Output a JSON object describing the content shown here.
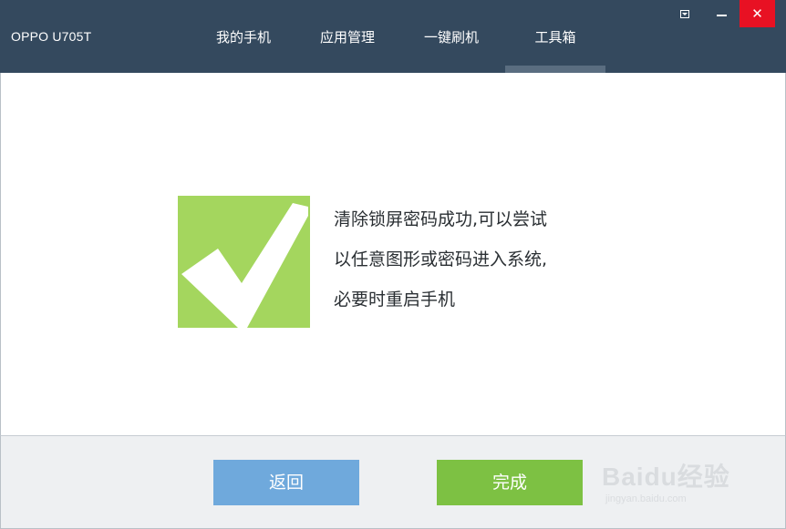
{
  "window": {
    "device_name": "OPPO U705T",
    "close_glyph": "✕"
  },
  "nav": {
    "tabs": [
      {
        "label": "我的手机"
      },
      {
        "label": "应用管理"
      },
      {
        "label": "一键刷机"
      },
      {
        "label": "工具箱",
        "active": true
      }
    ]
  },
  "message": {
    "lines": [
      "清除锁屏密码成功,可以尝试",
      "以任意图形或密码进入系统,",
      "必要时重启手机"
    ],
    "icon": "checkmark-icon",
    "icon_color": "#a4d65e"
  },
  "footer": {
    "back_label": "返回",
    "done_label": "完成"
  },
  "watermark": {
    "brand": "Baidu经验",
    "url": "jingyan.baidu.com"
  },
  "colors": {
    "titlebar": "#34495e",
    "close": "#e81123",
    "back_button": "#6fa9dc",
    "done_button": "#7dc143"
  }
}
